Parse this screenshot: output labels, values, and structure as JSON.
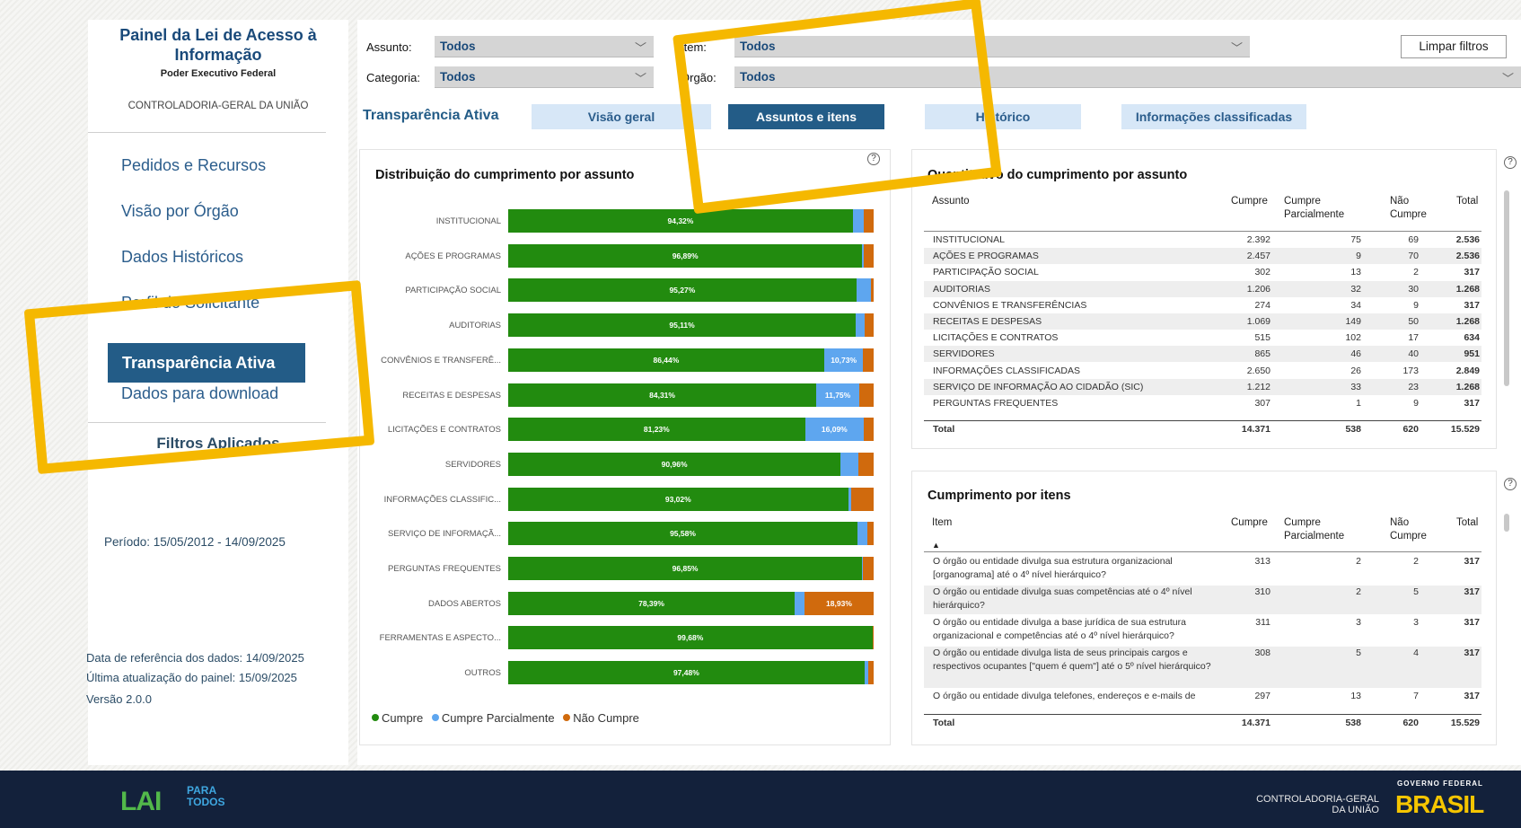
{
  "sidebar": {
    "title": "Painel da Lei de Acesso à Informação",
    "subtitle": "Poder Executivo Federal",
    "org": "CONTROLADORIA-GERAL DA UNIÃO",
    "nav": [
      "Pedidos e Recursos",
      "Visão por Órgão",
      "Dados Históricos",
      "Perfil do Solicitante",
      "Transparência Ativa",
      "Dados para download"
    ],
    "active_index": 4,
    "filters_title": "Filtros Aplicados",
    "period": "Período: 15/05/2012 - 14/09/2025",
    "ref_date": "Data de referência dos dados:  14/09/2025",
    "last_update": "Última atualização do painel:  15/09/2025",
    "version": "Versão 2.0.0"
  },
  "filters": {
    "assunto_label": "Assunto:",
    "assunto_value": "Todos",
    "item_label": "Item:",
    "item_value": "Todos",
    "categoria_label": "Categoria:",
    "categoria_value": "Todos",
    "orgao_label": "Órgão:",
    "orgao_value": "Todos",
    "clear_label": "Limpar filtros"
  },
  "section_title": "Transparência Ativa",
  "tabs": [
    "Visão geral",
    "Assuntos e itens",
    "Histórico",
    "Informações classificadas"
  ],
  "active_tab": 1,
  "chart_card": {
    "title": "Distribuição do cumprimento por assunto",
    "legend": [
      "Cumpre",
      "Cumpre Parcialmente",
      "Não Cumpre"
    ],
    "colors": {
      "cumpre": "#228b0f",
      "parcial": "#5ea6ef",
      "nao": "#d06a0d"
    }
  },
  "chart_data": {
    "type": "bar",
    "orientation": "horizontal-stacked-100",
    "categories": [
      "INSTITUCIONAL",
      "AÇÕES E PROGRAMAS",
      "PARTICIPAÇÃO SOCIAL",
      "AUDITORIAS",
      "CONVÊNIOS E TRANSFERÊ...",
      "RECEITAS E DESPESAS",
      "LICITAÇÕES E CONTRATOS",
      "SERVIDORES",
      "INFORMAÇÕES CLASSIFIC...",
      "SERVIÇO DE INFORMAÇÃ...",
      "PERGUNTAS FREQUENTES",
      "DADOS ABERTOS",
      "FERRAMENTAS E ASPECTO...",
      "OUTROS"
    ],
    "series": [
      {
        "name": "Cumpre",
        "values": [
          94.32,
          96.89,
          95.27,
          95.11,
          86.44,
          84.31,
          81.23,
          90.96,
          93.02,
          95.58,
          96.85,
          78.39,
          99.68,
          97.48
        ],
        "labels": [
          "94,32%",
          "96,89%",
          "95,27%",
          "95,11%",
          "86,44%",
          "84,31%",
          "81,23%",
          "90,96%",
          "93,02%",
          "95,58%",
          "96,85%",
          "78,39%",
          "99,68%",
          "97,48%"
        ]
      },
      {
        "name": "Cumpre Parcialmente",
        "values": [
          2.96,
          0.35,
          4.1,
          2.52,
          10.73,
          11.75,
          16.09,
          4.84,
          0.91,
          2.6,
          0.32,
          2.68,
          0.16,
          1.0
        ],
        "labels": [
          "",
          "",
          "",
          "",
          "10,73%",
          "11,75%",
          "16,09%",
          "",
          "",
          "",
          "",
          "",
          "",
          ""
        ]
      },
      {
        "name": "Não Cumpre",
        "values": [
          2.72,
          2.76,
          0.63,
          2.37,
          2.83,
          3.94,
          2.68,
          4.2,
          6.07,
          1.82,
          2.83,
          18.93,
          0.16,
          1.52
        ],
        "labels": [
          "",
          "",
          "",
          "",
          "",
          "",
          "",
          "",
          "",
          "",
          "",
          "18,93%",
          "",
          ""
        ]
      }
    ]
  },
  "qty_table": {
    "title": "Quantitativo do cumprimento por assunto",
    "headers": [
      "Assunto",
      "Cumpre",
      "Cumpre Parcialmente",
      "Não Cumpre",
      "Total"
    ],
    "rows": [
      [
        "INSTITUCIONAL",
        "2.392",
        "75",
        "69",
        "2.536"
      ],
      [
        "AÇÕES E PROGRAMAS",
        "2.457",
        "9",
        "70",
        "2.536"
      ],
      [
        "PARTICIPAÇÃO SOCIAL",
        "302",
        "13",
        "2",
        "317"
      ],
      [
        "AUDITORIAS",
        "1.206",
        "32",
        "30",
        "1.268"
      ],
      [
        "CONVÊNIOS E TRANSFERÊNCIAS",
        "274",
        "34",
        "9",
        "317"
      ],
      [
        "RECEITAS E DESPESAS",
        "1.069",
        "149",
        "50",
        "1.268"
      ],
      [
        "LICITAÇÕES E CONTRATOS",
        "515",
        "102",
        "17",
        "634"
      ],
      [
        "SERVIDORES",
        "865",
        "46",
        "40",
        "951"
      ],
      [
        "INFORMAÇÕES CLASSIFICADAS",
        "2.650",
        "26",
        "173",
        "2.849"
      ],
      [
        "SERVIÇO DE INFORMAÇÃO AO CIDADÃO (SIC)",
        "1.212",
        "33",
        "23",
        "1.268"
      ],
      [
        "PERGUNTAS FREQUENTES",
        "307",
        "1",
        "9",
        "317"
      ]
    ],
    "total": [
      "Total",
      "14.371",
      "538",
      "620",
      "15.529"
    ]
  },
  "items_table": {
    "title": "Cumprimento por itens",
    "headers": [
      "Item",
      "Cumpre",
      "Cumpre Parcialmente",
      "Não Cumpre",
      "Total"
    ],
    "rows": [
      [
        "O órgão ou entidade divulga sua estrutura organizacional [organograma] até o 4º nível hierárquico?",
        "313",
        "2",
        "2",
        "317"
      ],
      [
        "O órgão ou entidade divulga suas competências até o 4º nível hierárquico?",
        "310",
        "2",
        "5",
        "317"
      ],
      [
        "O órgão ou entidade divulga a base jurídica de sua estrutura organizacional e competências até o 4º nível hierárquico?",
        "311",
        "3",
        "3",
        "317"
      ],
      [
        "O órgão ou entidade divulga lista de seus principais cargos e respectivos ocupantes [\"quem é quem\"] até o 5º nível hierárquico?",
        "308",
        "5",
        "4",
        "317"
      ],
      [
        "O órgão ou entidade divulga telefones, endereços e e-mails de",
        "297",
        "13",
        "7",
        "317"
      ]
    ],
    "total": [
      "Total",
      "14.371",
      "538",
      "620",
      "15.529"
    ]
  },
  "footer": {
    "logo_main": "LAI",
    "logo_sub1": "PARA",
    "logo_sub2": "TODOS",
    "cgu1": "CONTROLADORIA-GERAL",
    "cgu2": "DA UNIÃO",
    "gov_top": "GOVERNO FEDERAL",
    "gov_main": "BRASIL"
  }
}
